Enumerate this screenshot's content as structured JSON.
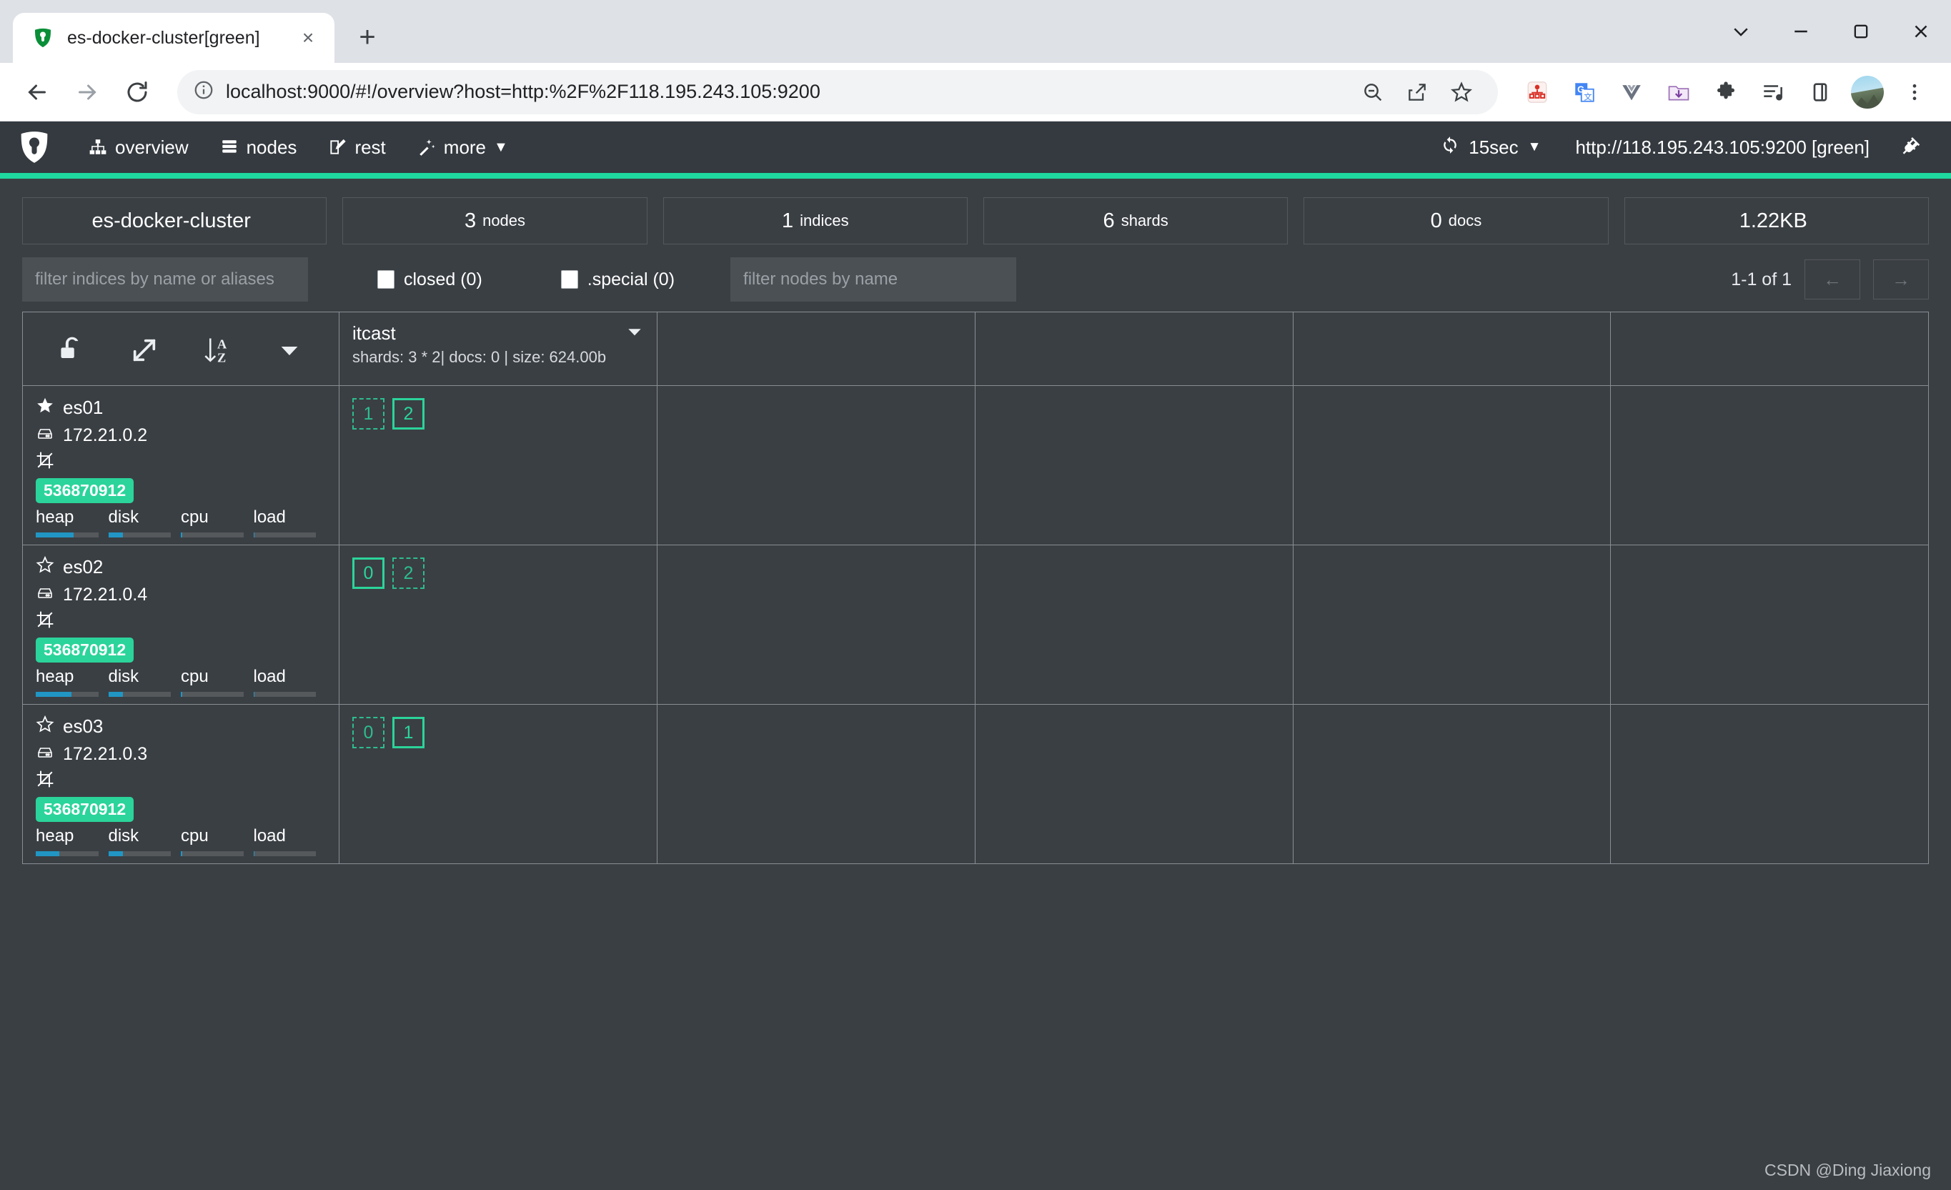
{
  "browser": {
    "tab": {
      "title": "es-docker-cluster[green]",
      "favicon": "cerebro-logo-icon",
      "close": "×"
    },
    "newtab_label": "+",
    "window_controls": {
      "tab_search": "tab-search-icon",
      "minimize": "minimize-icon",
      "maximize": "maximize-icon",
      "close": "close-icon"
    },
    "toolbar": {
      "back": "back-arrow-icon",
      "forward": "forward-arrow-icon",
      "reload": "reload-icon",
      "url": "localhost:9000/#!/overview?host=http:%2F%2F118.195.243.105:9200",
      "site_info": "info-circle-icon",
      "zoom_out": "zoom-out-icon",
      "share": "share-icon",
      "bookmark": "bookmark-star-icon",
      "extensions": [
        {
          "name": "sitemap-extension-icon"
        },
        {
          "name": "google-translate-icon"
        },
        {
          "name": "vue-devtools-icon"
        },
        {
          "name": "download-folder-icon"
        },
        {
          "name": "puzzle-extensions-icon"
        },
        {
          "name": "playlist-icon"
        },
        {
          "name": "side-panel-icon"
        }
      ],
      "profile": "avatar",
      "menu": "three-dot-menu-icon"
    }
  },
  "navbar": {
    "logo": "cerebro-logo-icon",
    "items": [
      {
        "label": "overview",
        "icon": "sitemap-icon"
      },
      {
        "label": "nodes",
        "icon": "server-icon"
      },
      {
        "label": "rest",
        "icon": "edit-icon"
      },
      {
        "label": "more",
        "icon": "magic-wand-icon",
        "caret": "▼"
      }
    ],
    "refresh": {
      "icon": "refresh-icon",
      "label": "15sec",
      "caret": "▼"
    },
    "host": "http://118.195.243.105:9200 [green]",
    "disconnect": "plug-icon",
    "status_color": "#1ed8a0"
  },
  "stats": [
    {
      "big": "es-docker-cluster",
      "small": ""
    },
    {
      "big": "3",
      "small": "nodes"
    },
    {
      "big": "1",
      "small": "indices"
    },
    {
      "big": "6",
      "small": "shards"
    },
    {
      "big": "0",
      "small": "docs"
    },
    {
      "big": "1.22KB",
      "small": ""
    }
  ],
  "filters": {
    "indices_placeholder": "filter indices by name or aliases",
    "indices_value": "",
    "closed_label": "closed (0)",
    "special_label": ".special (0)",
    "nodes_placeholder": "filter nodes by name",
    "nodes_value": "",
    "pager_label": "1-1 of 1",
    "prev": "←",
    "next": "→"
  },
  "grid": {
    "header_tools": [
      {
        "name": "unlock-icon"
      },
      {
        "name": "expand-icon"
      },
      {
        "name": "sort-az-icon"
      },
      {
        "name": "caret-down-icon"
      }
    ],
    "index": {
      "name": "itcast",
      "meta": "shards: 3 * 2| docs: 0 | size: 624.00b",
      "caret": "▼"
    },
    "metric_labels": [
      "heap",
      "disk",
      "cpu",
      "load"
    ],
    "nodes": [
      {
        "name": "es01",
        "master": true,
        "star": "star-filled-icon",
        "ip": "172.21.0.2",
        "hdd_icon": "hdd-icon",
        "role_icon": "crop-icon",
        "heap_badge": "536870912",
        "metrics": [
          60,
          23,
          2,
          2
        ],
        "shards": [
          {
            "label": "1",
            "type": "replica"
          },
          {
            "label": "2",
            "type": "primary"
          }
        ]
      },
      {
        "name": "es02",
        "master": false,
        "star": "star-outline-icon",
        "ip": "172.21.0.4",
        "hdd_icon": "hdd-icon",
        "role_icon": "crop-icon",
        "heap_badge": "536870912",
        "metrics": [
          57,
          23,
          2,
          2
        ],
        "shards": [
          {
            "label": "0",
            "type": "primary"
          },
          {
            "label": "2",
            "type": "replica"
          }
        ]
      },
      {
        "name": "es03",
        "master": false,
        "star": "star-outline-icon",
        "ip": "172.21.0.3",
        "hdd_icon": "hdd-icon",
        "role_icon": "crop-icon",
        "heap_badge": "536870912",
        "metrics": [
          38,
          23,
          2,
          2
        ],
        "shards": [
          {
            "label": "0",
            "type": "replica"
          },
          {
            "label": "1",
            "type": "primary"
          }
        ]
      }
    ]
  },
  "watermark": "CSDN @Ding Jiaxiong",
  "colors": {
    "accent_green": "#2bd49a",
    "status_bar": "#1ed8a0",
    "bar_blue": "#2196c4",
    "app_bg": "#3a3f44",
    "navbar_bg": "#343a40"
  }
}
